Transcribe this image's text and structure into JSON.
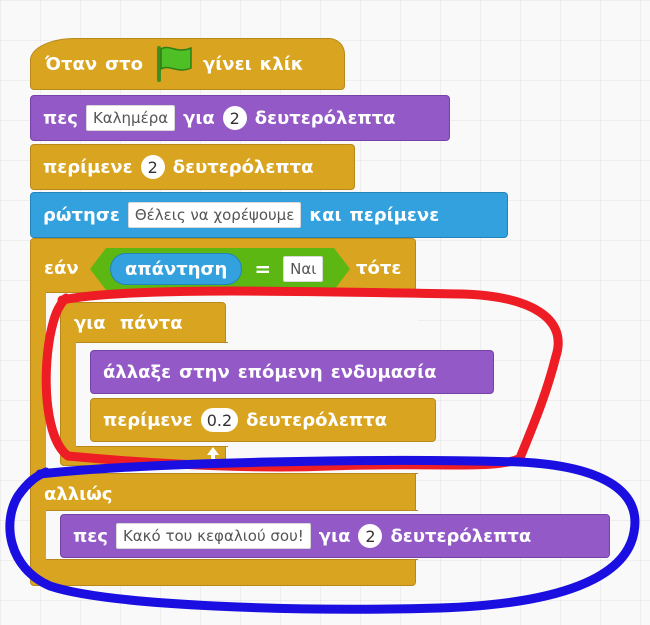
{
  "script": {
    "when_flag": {
      "before": "Όταν",
      "middle": "στο",
      "after_1": "γίνει",
      "after_2": "κλίκ",
      "icon": "green-flag-icon"
    },
    "say1": {
      "verb": "πες",
      "text": "Καλημέρα",
      "for": "για",
      "secs": "2",
      "unit": "δευτερόλεπτα"
    },
    "wait1": {
      "verb": "περίμενε",
      "secs": "2",
      "unit": "δευτερόλεπτα"
    },
    "ask": {
      "verb": "ρώτησε",
      "question": "Θέλεις να χορέψουμε",
      "and": "και",
      "wait": "περίμενε"
    },
    "if_else": {
      "if_label": "εάν",
      "answer": "απάντηση",
      "equals": "=",
      "value": "Ναι",
      "then_label": "τότε",
      "else_label": "αλλιώς"
    },
    "forever": {
      "label_1": "για",
      "label_2": "πάντα",
      "next_costume": {
        "w1": "άλλαξε",
        "w2": "στην",
        "w3": "επόμενη",
        "w4": "ενδυμασία"
      },
      "wait": {
        "verb": "περίμενε",
        "secs": "0.2",
        "unit": "δευτερόλεπτα"
      },
      "loop_icon": "loop-arrow-icon"
    },
    "say2": {
      "verb": "πες",
      "text": "Κακό του κεφαλιού σου!",
      "for": "για",
      "secs": "2",
      "unit": "δευτερόλεπτα"
    }
  },
  "annotations": {
    "red_outline_color": "#ee1c24",
    "blue_outline_color": "#1a0fe0"
  },
  "colors": {
    "events": "#d9a520",
    "looks": "#9359c6",
    "sensing": "#33a1de",
    "operators": "#5cb712",
    "flag": "#4fbf26"
  }
}
